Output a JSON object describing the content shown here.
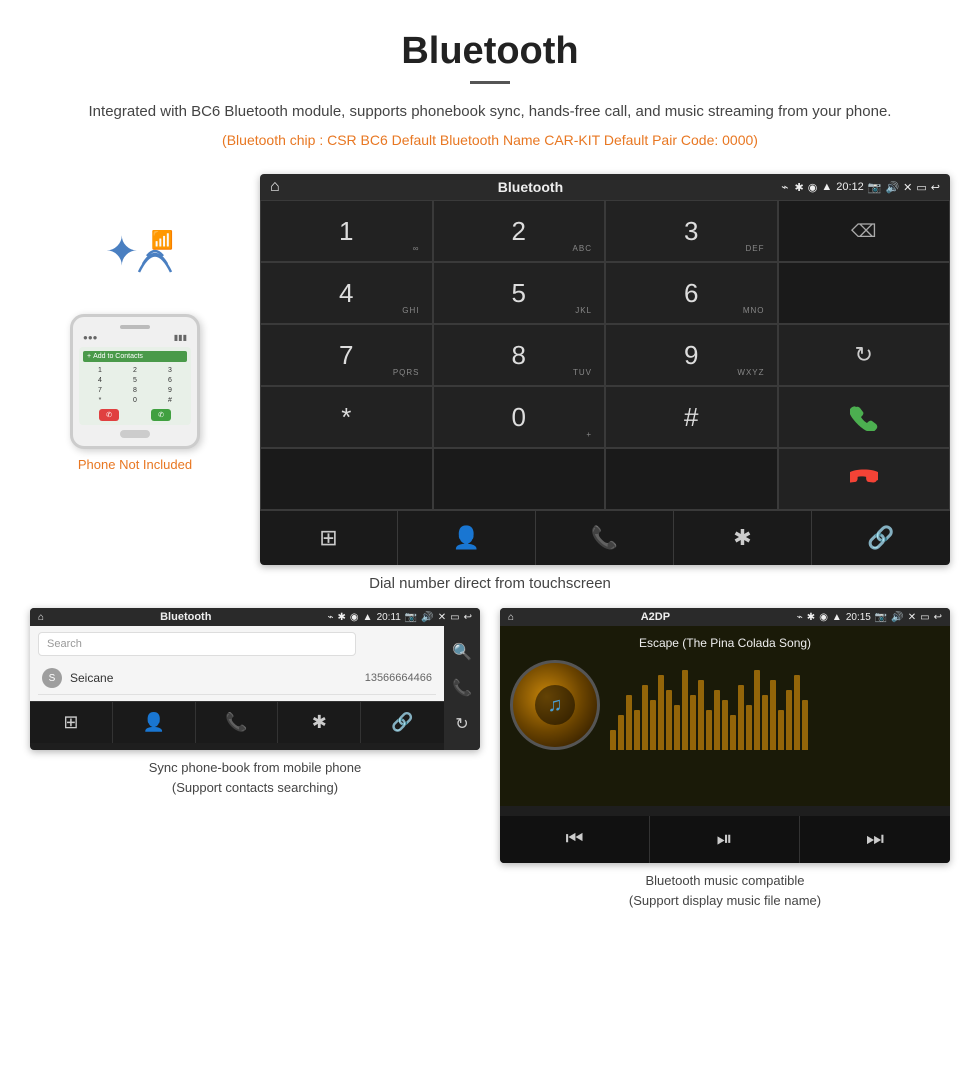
{
  "header": {
    "title": "Bluetooth",
    "description": "Integrated with BC6 Bluetooth module, supports phonebook sync, hands-free call, and music streaming from your phone.",
    "specs": "(Bluetooth chip : CSR BC6    Default Bluetooth Name CAR-KIT    Default Pair Code: 0000)"
  },
  "phone_sidebar": {
    "not_included_label": "Phone Not Included"
  },
  "car_dialpad_screen": {
    "status_bar": {
      "title": "Bluetooth",
      "time": "20:12"
    },
    "keys": [
      {
        "label": "1",
        "sub": "∞"
      },
      {
        "label": "2",
        "sub": "ABC"
      },
      {
        "label": "3",
        "sub": "DEF"
      },
      {
        "label": "",
        "sub": ""
      },
      {
        "label": "4",
        "sub": "GHI"
      },
      {
        "label": "5",
        "sub": "JKL"
      },
      {
        "label": "6",
        "sub": "MNO"
      },
      {
        "label": "",
        "sub": ""
      },
      {
        "label": "7",
        "sub": "PQRS"
      },
      {
        "label": "8",
        "sub": "TUV"
      },
      {
        "label": "9",
        "sub": "WXYZ"
      },
      {
        "label": "↻",
        "sub": ""
      },
      {
        "label": "*",
        "sub": ""
      },
      {
        "label": "0",
        "sub": "+"
      },
      {
        "label": "#",
        "sub": ""
      },
      {
        "label": "📞",
        "sub": ""
      },
      {
        "label": "📵",
        "sub": ""
      }
    ],
    "bottom_icons": [
      "⊞",
      "👤",
      "📞",
      "✱",
      "🔗"
    ]
  },
  "dial_caption": "Dial number direct from touchscreen",
  "phonebook_screen": {
    "status_bar": {
      "title": "Bluetooth",
      "time": "20:11"
    },
    "search_placeholder": "Search",
    "contacts": [
      {
        "letter": "S",
        "name": "Seicane",
        "number": "13566664466"
      }
    ]
  },
  "phonebook_caption": "Sync phone-book from mobile phone\n(Support contacts searching)",
  "music_screen": {
    "status_bar": {
      "title": "A2DP",
      "time": "20:15"
    },
    "song_title": "Escape (The Pina Colada Song)"
  },
  "music_caption": "Bluetooth music compatible\n(Support display music file name)",
  "viz_bars": [
    20,
    35,
    55,
    40,
    65,
    50,
    75,
    60,
    45,
    80,
    55,
    70,
    40,
    60,
    50,
    35,
    65,
    45,
    80,
    55,
    70,
    40,
    60,
    75,
    50
  ]
}
